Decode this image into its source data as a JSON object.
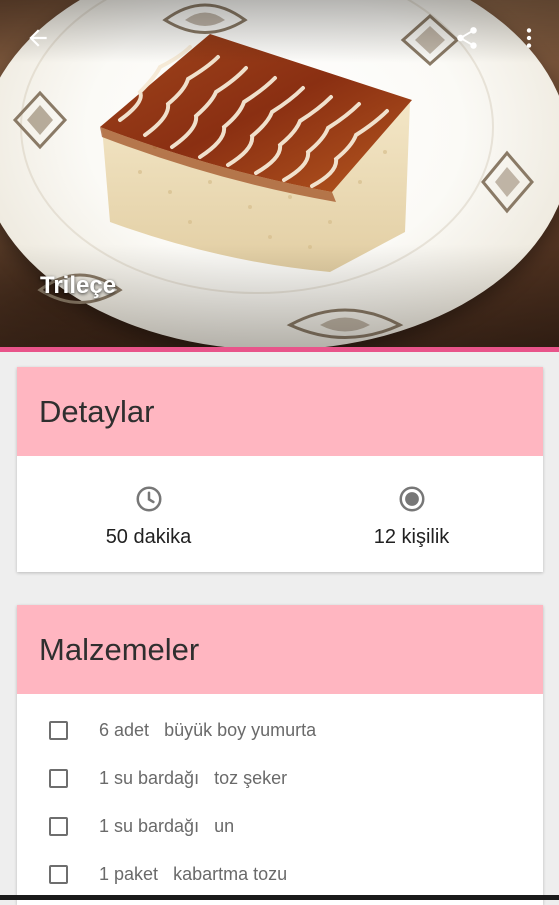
{
  "header": {
    "title": "Trileçe",
    "back_icon": "arrow-back-icon",
    "share_icon": "share-icon",
    "more_icon": "more-vert-icon"
  },
  "colors": {
    "accent": "#e8548a",
    "card_header": "#ffb6c1"
  },
  "details": {
    "title": "Detaylar",
    "time": {
      "icon": "clock-icon",
      "value": "50 dakika"
    },
    "servings": {
      "icon": "radio-icon",
      "value": "12 kişilik"
    }
  },
  "ingredients": {
    "title": "Malzemeler",
    "items": [
      {
        "amount": "6 adet",
        "name": "büyük boy yumurta"
      },
      {
        "amount": "1 su bardağı",
        "name": "toz şeker"
      },
      {
        "amount": "1 su bardağı",
        "name": "un"
      },
      {
        "amount": "1 paket",
        "name": "kabartma tozu"
      }
    ]
  }
}
